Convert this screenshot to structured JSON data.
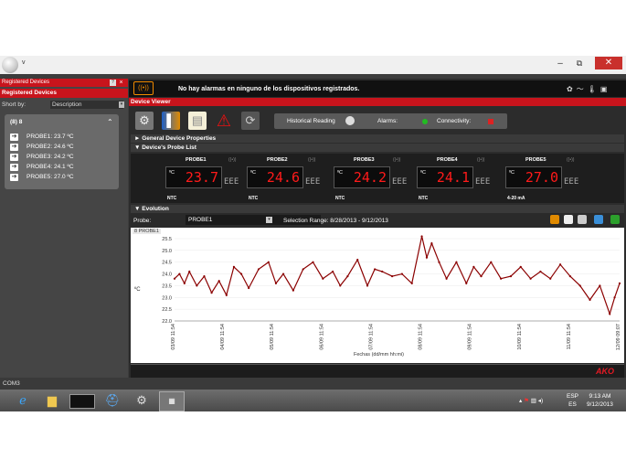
{
  "window": {
    "title": "v",
    "minimize": "–",
    "maximize": "⧉",
    "close": "✕"
  },
  "sidebar": {
    "panel_title": "Registered Devices",
    "registered_devices": "Registered Devices",
    "sort_label": "Short by:",
    "sort_value": "Description",
    "group_title": "(8) 8",
    "group_collapse": "⌃",
    "probes": [
      {
        "label": "PROBE1: 23.7 ºC"
      },
      {
        "label": "PROBE2: 24.6 ºC"
      },
      {
        "label": "PROBE3: 24.2 ºC"
      },
      {
        "label": "PROBE4: 24.1 ºC"
      },
      {
        "label": "PROBE5: 27.0 ºC"
      }
    ]
  },
  "alarm": {
    "icon_text": "((•))",
    "message": "No hay alarmas en ninguno de los dispositivos registrados."
  },
  "device_viewer": {
    "title": "Device Viewer",
    "historical_reading": "Historical Reading",
    "alarms": "Alarms:",
    "connectivity": "Connectivity:",
    "alarms_color": "#22bb22",
    "connectivity_color": "#dd2222"
  },
  "sections": {
    "general": "► General Device Properties",
    "probe_list": "▼ Device's Probe List",
    "evolution": "▼ Evolution"
  },
  "probe_list": [
    {
      "name": "PROBE1",
      "unit": "ºC",
      "value": "23.7",
      "type": "NTC",
      "eee": "EEE"
    },
    {
      "name": "PROBE2",
      "unit": "ºC",
      "value": "24.6",
      "type": "NTC",
      "eee": "EEE"
    },
    {
      "name": "PROBE3",
      "unit": "ºC",
      "value": "24.2",
      "type": "NTC",
      "eee": "EEE"
    },
    {
      "name": "PROBE4",
      "unit": "ºC",
      "value": "24.1",
      "type": "NTC",
      "eee": "EEE"
    },
    {
      "name": "PROBE5",
      "unit": "ºC",
      "value": "27.0",
      "type": "4-20 mA",
      "eee": "EEE"
    }
  ],
  "evolution": {
    "probe_label": "Probe:",
    "probe_value": "PROBE1",
    "selection_range": "Selection Range: 8/28/2013 - 9/12/2013"
  },
  "chart_data": {
    "type": "line",
    "legend": "8 PROBE1",
    "ylabel": "ºC",
    "xlabel": "Fechas (dd/mm hh:mi)",
    "ylim": [
      22.0,
      25.5
    ],
    "yticks": [
      "25.5",
      "25.0",
      "24.5",
      "24.0",
      "23.5",
      "23.0",
      "22.5",
      "22.0"
    ],
    "xticks": [
      "03/09 11:54",
      "04/09 11:54",
      "05/09 11:54",
      "06/09 11:54",
      "07/09 11:54",
      "08/09 11:54",
      "09/09 11:54",
      "10/09 11:54",
      "11/09 11:54",
      "12/09 09:07"
    ],
    "x": [
      0,
      0.1,
      0.2,
      0.3,
      0.45,
      0.6,
      0.75,
      0.9,
      1.05,
      1.2,
      1.35,
      1.5,
      1.7,
      1.9,
      2.05,
      2.2,
      2.4,
      2.6,
      2.8,
      3.0,
      3.2,
      3.35,
      3.5,
      3.7,
      3.9,
      4.05,
      4.2,
      4.4,
      4.6,
      4.8,
      5.0,
      5.1,
      5.2,
      5.35,
      5.5,
      5.7,
      5.9,
      6.05,
      6.2,
      6.4,
      6.6,
      6.8,
      7.0,
      7.2,
      7.4,
      7.6,
      7.8,
      8.0,
      8.2,
      8.4,
      8.6,
      8.8,
      8.9,
      9.0
    ],
    "series": [
      {
        "name": "8 PROBE1",
        "color": "#8b0000",
        "values": [
          23.8,
          24.0,
          23.6,
          24.1,
          23.5,
          23.9,
          23.2,
          23.7,
          23.1,
          24.3,
          24.0,
          23.4,
          24.2,
          24.5,
          23.6,
          24.0,
          23.3,
          24.2,
          24.5,
          23.8,
          24.1,
          23.5,
          23.9,
          24.6,
          23.5,
          24.2,
          24.1,
          23.9,
          24.0,
          23.6,
          25.6,
          24.7,
          25.3,
          24.5,
          23.8,
          24.5,
          23.6,
          24.3,
          23.9,
          24.5,
          23.8,
          23.9,
          24.3,
          23.8,
          24.1,
          23.8,
          24.4,
          23.9,
          23.5,
          22.9,
          23.5,
          22.3,
          23.0,
          23.6
        ]
      }
    ]
  },
  "status": {
    "brand": "AKO",
    "port": "COM3"
  },
  "taskbar": {
    "items": [
      "ie",
      "explorer",
      "cmd",
      "device",
      "settings",
      "app"
    ],
    "lang_top": "ESP",
    "lang_bottom": "ES",
    "time": "9:13 AM",
    "date": "9/12/2013"
  }
}
